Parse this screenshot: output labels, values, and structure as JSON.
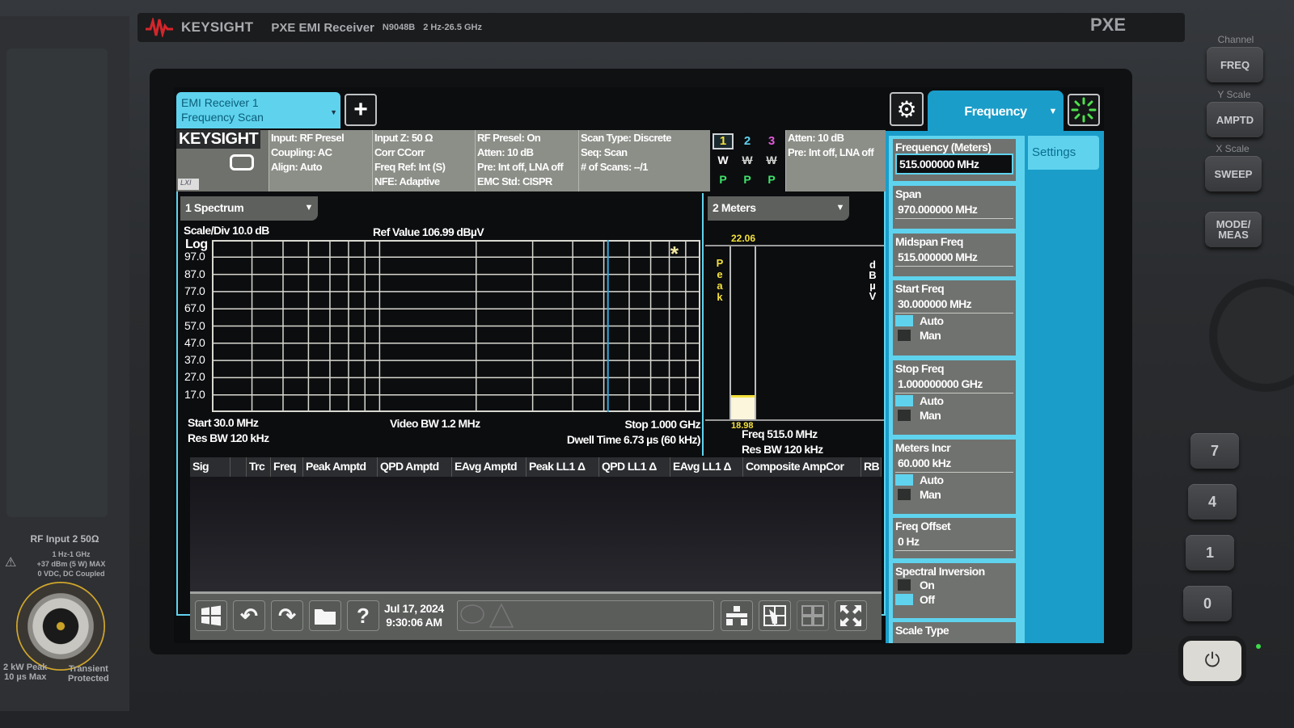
{
  "instrument": {
    "brand": "KEYSIGHT",
    "model": "PXE EMI Receiver",
    "model_number": "N9048B",
    "freq_range": "2 Hz-26.5 GHz",
    "series": "PXE"
  },
  "front_panel": {
    "rf_input": {
      "label": "RF Input 2 50Ω",
      "spec_lines": [
        "1 Hz-1 GHz",
        "+37 dBm (5 W) MAX",
        "0 VDC, DC Coupled"
      ],
      "left_note": [
        "2 kW Peak",
        "10 µs Max"
      ],
      "right_note": [
        "Transient",
        "Protected"
      ]
    },
    "hard_keys": {
      "groups": [
        {
          "label": "Channel",
          "key": "FREQ"
        },
        {
          "label": "Y Scale",
          "key": "AMPTD"
        },
        {
          "label": "X Scale",
          "key": "SWEEP"
        }
      ],
      "mode_meas": "MODE/\nMEAS",
      "numeric": [
        "7",
        "4",
        "1",
        "0"
      ]
    }
  },
  "app": {
    "tab_line1": "EMI Receiver 1",
    "tab_line2": "Frequency Scan",
    "add_label": "+"
  },
  "info_bar": {
    "logo": "KEYSIGHT",
    "lxi": "LXI",
    "col1": [
      "Input: RF Presel",
      "Coupling: AC",
      "Align: Auto"
    ],
    "col2": [
      "Input Z: 50 Ω",
      "Corr CCorr",
      "Freq Ref: Int (S)",
      "NFE: Adaptive"
    ],
    "col3": [
      "RF Presel: On",
      "Atten: 10 dB",
      "Pre: Int off, LNA off",
      "EMC Std: CISPR"
    ],
    "col4": [
      "Scan Type: Discrete",
      "Seq: Scan",
      "# of Scans: --/1"
    ],
    "traces": [
      {
        "num": "1",
        "color": "#f4e13c",
        "mode": "W",
        "det": "P",
        "selected": true
      },
      {
        "num": "2",
        "color": "#5fd3ee",
        "mode": "W",
        "det": "P",
        "selected": false
      },
      {
        "num": "3",
        "color": "#e05ad8",
        "mode": "W",
        "det": "P",
        "selected": false
      }
    ],
    "col5": [
      "Atten: 10 dB",
      "Pre: Int off, LNA off"
    ]
  },
  "spectrum": {
    "window_title": "1 Spectrum",
    "scale_div": "Scale/Div 10.0 dB",
    "ref_value": "Ref Value 106.99 dBµV",
    "scale_type": "Log",
    "start": "Start 30.0 MHz",
    "res_bw": "Res BW 120 kHz",
    "video_bw": "Video BW 1.2 MHz",
    "stop": "Stop 1.000 GHz",
    "dwell": "Dwell Time 6.73 µs (60 kHz)",
    "marker_symbol": "*"
  },
  "chart_data": {
    "type": "line",
    "title": "1 Spectrum",
    "xlabel": "Frequency",
    "ylabel": "dBµV",
    "x_scale": "log",
    "xlim_mhz": [
      30,
      1000
    ],
    "ylim": [
      6.99,
      106.99
    ],
    "yticks": [
      "97.0",
      "87.0",
      "77.0",
      "67.0",
      "57.0",
      "47.0",
      "37.0",
      "27.0",
      "17.0"
    ],
    "ytick_values": [
      96.99,
      86.99,
      76.99,
      66.99,
      56.99,
      46.99,
      36.99,
      26.99,
      16.99
    ],
    "xgrid_mhz": [
      40,
      50,
      60,
      70,
      80,
      90,
      100,
      200,
      300,
      400,
      500,
      600,
      700,
      800,
      900
    ],
    "meter_freq_mhz": 515,
    "marker_freq_mhz": 830,
    "grid": true,
    "series": []
  },
  "meters": {
    "window_title": "2 Meters",
    "detector": "Peak",
    "unit": "dBµV",
    "top_value": "22.06",
    "bottom_value": "18.98",
    "fill_fraction": 0.14,
    "freq": "Freq 515.0 MHz",
    "res_bw": "Res BW 120 kHz"
  },
  "table": {
    "columns": [
      "Sig",
      "",
      "Trc",
      "Freq",
      "Peak Amptd",
      "QPD Amptd",
      "EAvg Amptd",
      "Peak LL1 Δ",
      "QPD LL1 Δ",
      "EAvg LL1 Δ",
      "Composite AmpCor",
      "RB"
    ]
  },
  "taskbar": {
    "date": "Jul 17, 2024",
    "time": "9:30:06 AM",
    "buttons": [
      "windows",
      "undo",
      "redo",
      "file",
      "help"
    ]
  },
  "menu_panel": {
    "gear": "⚙",
    "title": "Frequency",
    "settings_tab": "Settings",
    "softkeys": [
      {
        "label": "Frequency (Meters)",
        "value": "515.000000 MHz",
        "active": true
      },
      {
        "label": "Span",
        "value": "970.000000 MHz"
      },
      {
        "label": "Midspan Freq",
        "value": "515.000000 MHz"
      },
      {
        "label": "Start Freq",
        "value": "30.000000 MHz",
        "radio": [
          "Auto",
          "Man"
        ],
        "selected": "Auto"
      },
      {
        "label": "Stop Freq",
        "value": "1.000000000 GHz",
        "radio": [
          "Auto",
          "Man"
        ],
        "selected": "Auto"
      },
      {
        "label": "Meters Incr",
        "value": "60.000 kHz",
        "radio": [
          "Auto",
          "Man"
        ],
        "selected": "Auto"
      },
      {
        "label": "Freq Offset",
        "value": "0 Hz"
      },
      {
        "label": "Spectral Inversion",
        "radio": [
          "On",
          "Off"
        ],
        "selected": "Off"
      },
      {
        "label": "Scale Type"
      }
    ]
  }
}
